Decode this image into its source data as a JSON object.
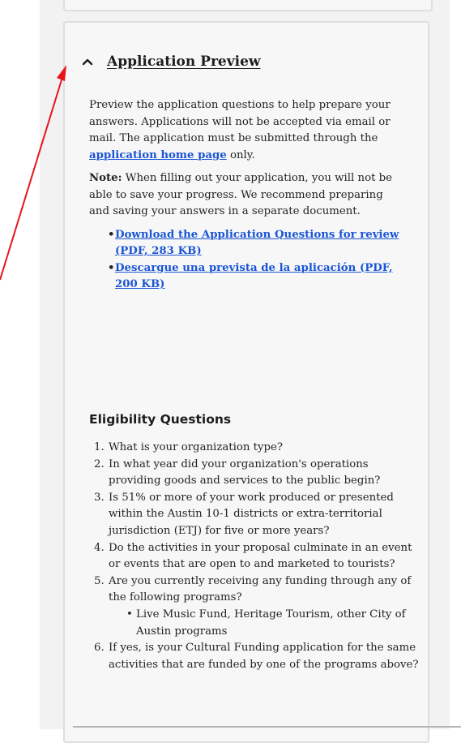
{
  "accordion": {
    "title": "Application Preview",
    "expanded": true,
    "icon": "chevron-up-icon"
  },
  "intro": {
    "text_before_link": "Preview the application questions to help prepare your answers. Applications will not be accepted via email or mail. The application must be submitted through the ",
    "link_text": "application home page",
    "text_after_link": " only."
  },
  "note": {
    "label": "Note:",
    "text": " When filling out your application, you will not be able to save your progress. We recommend preparing and saving your answers in a separate document."
  },
  "downloads": [
    {
      "label": "Download the Application Questions for review (PDF, 283 KB)"
    },
    {
      "label": "Descargue una prevista de la aplicación (PDF, 200 KB)"
    }
  ],
  "eligibility": {
    "heading": "Eligibility Questions",
    "questions": [
      {
        "num": "1.",
        "text": "What is your organization type?"
      },
      {
        "num": "2.",
        "text": "In what year did your organization's operations providing goods and services to the public begin?"
      },
      {
        "num": "3.",
        "text": "Is 51% or more of your work produced or presented within the Austin 10-1 districts or extra-territorial jurisdiction (ETJ) for five or more years?"
      },
      {
        "num": "4.",
        "text": "Do the activities in your proposal culminate in an event or events that are open to and marketed to tourists?"
      },
      {
        "num": "5.",
        "text": "Are you currently receiving any funding through any of the following programs?",
        "sub": "Live Music Fund, Heritage Tourism, other City of Austin programs"
      },
      {
        "num": "6.",
        "text": "If yes, is your Cultural Funding application for the same activities that are funded by one of the programs above?"
      }
    ]
  },
  "colors": {
    "link": "#1a55d6",
    "annotation_arrow": "#e8141b",
    "card_bg": "#f7f7f7"
  }
}
